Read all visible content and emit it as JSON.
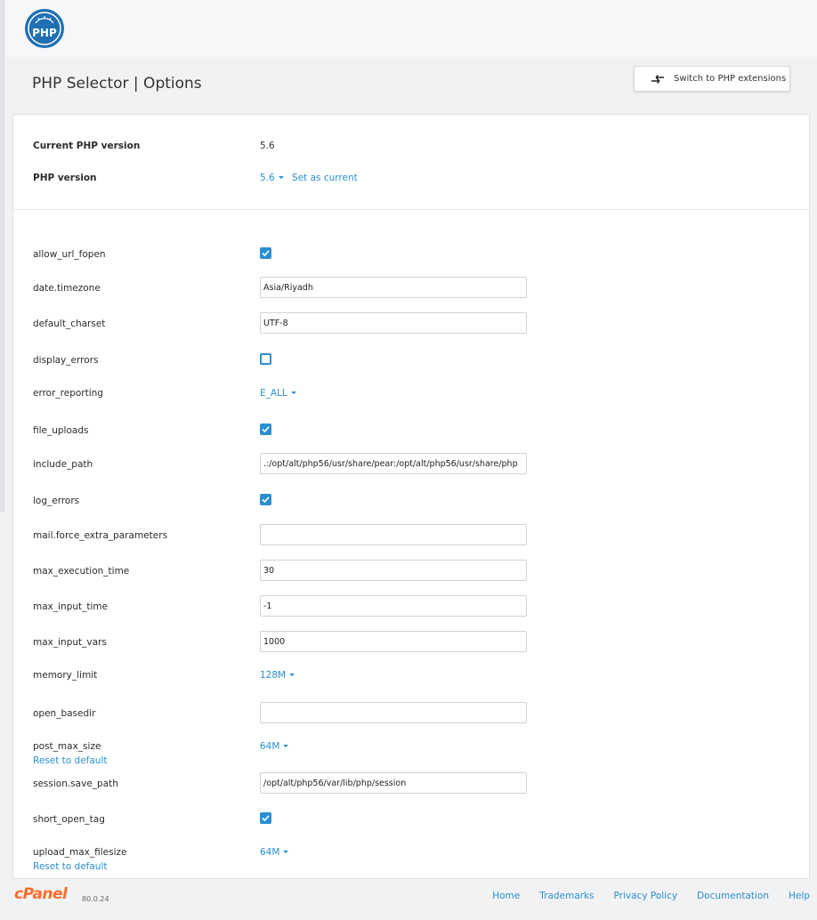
{
  "header": {
    "logo_text": "PHP",
    "title": "PHP Selector | Options",
    "switch_label": "Switch to PHP extensions"
  },
  "version": {
    "current_label": "Current PHP version",
    "current_value": "5.6",
    "php_label": "PHP version",
    "php_value": "5.6",
    "set_current": "Set as current"
  },
  "options": [
    {
      "name": "allow_url_fopen",
      "type": "checkbox",
      "checked": true
    },
    {
      "name": "date.timezone",
      "type": "text",
      "value": "Asia/Riyadh"
    },
    {
      "name": "default_charset",
      "type": "text",
      "value": "UTF-8"
    },
    {
      "name": "display_errors",
      "type": "checkbox",
      "checked": false
    },
    {
      "name": "error_reporting",
      "type": "dropdown",
      "value": "E_ALL"
    },
    {
      "name": "file_uploads",
      "type": "checkbox",
      "checked": true
    },
    {
      "name": "include_path",
      "type": "text",
      "value": ".:/opt/alt/php56/usr/share/pear:/opt/alt/php56/usr/share/php"
    },
    {
      "name": "log_errors",
      "type": "checkbox",
      "checked": true
    },
    {
      "name": "mail.force_extra_parameters",
      "type": "text",
      "value": ""
    },
    {
      "name": "max_execution_time",
      "type": "text",
      "value": "30"
    },
    {
      "name": "max_input_time",
      "type": "text",
      "value": "-1"
    },
    {
      "name": "max_input_vars",
      "type": "text",
      "value": "1000"
    },
    {
      "name": "memory_limit",
      "type": "dropdown",
      "value": "128M"
    },
    {
      "name": "open_basedir",
      "type": "text",
      "value": ""
    },
    {
      "name": "post_max_size",
      "type": "dropdown",
      "value": "64M",
      "reset": "Reset to default"
    },
    {
      "name": "session.save_path",
      "type": "text",
      "value": "/opt/alt/php56/var/lib/php/session"
    },
    {
      "name": "short_open_tag",
      "type": "checkbox",
      "checked": true
    },
    {
      "name": "upload_max_filesize",
      "type": "dropdown",
      "value": "64M",
      "reset": "Reset to default"
    }
  ],
  "footer": {
    "brand": "cPanel",
    "version": "80.0.24",
    "links": [
      "Home",
      "Trademarks",
      "Privacy Policy",
      "Documentation",
      "Help"
    ]
  },
  "colors": {
    "accent": "#2a8fd1",
    "brand_orange": "#ff6c2c",
    "logo_blue": "#1f6fb2"
  }
}
